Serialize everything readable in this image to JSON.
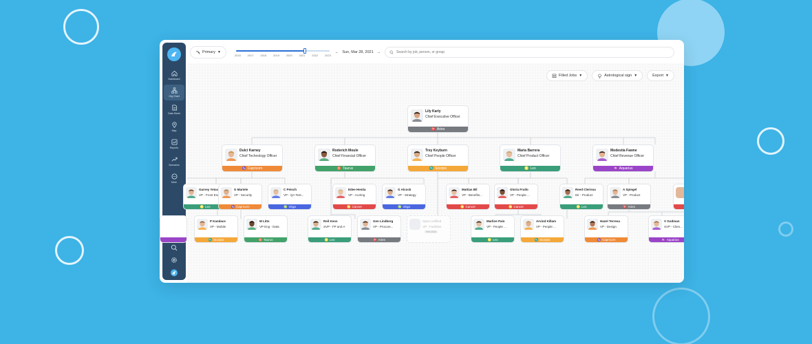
{
  "colors": {
    "background": "#3db3e6",
    "sidebar": "#2c4a68",
    "aries": "#777b80",
    "capricorn": "#ef8a38",
    "taurus": "#43a26a",
    "scorpio": "#f4a83a",
    "leo": "#3a9e7a",
    "aquarius": "#9a45c8",
    "virgo": "#4a67e0",
    "cancer": "#e24a4a"
  },
  "sidebar": {
    "items": [
      {
        "label": "Dashboard",
        "icon": "home-icon"
      },
      {
        "label": "Org Chart",
        "icon": "org-chart-icon",
        "active": true
      },
      {
        "label": "Data Sheet",
        "icon": "sheet-icon"
      },
      {
        "label": "Map",
        "icon": "map-pin-icon"
      },
      {
        "label": "Reports",
        "icon": "report-icon"
      },
      {
        "label": "Scenarios",
        "icon": "scenario-icon"
      },
      {
        "label": "More",
        "icon": "more-icon"
      }
    ],
    "bottom_icons": [
      "eye-icon",
      "search-icon",
      "gear-icon",
      "logo-icon"
    ]
  },
  "toolbar": {
    "view_select": "Primary",
    "years": [
      "2016",
      "2017",
      "2018",
      "2019",
      "2020",
      "2021",
      "2022",
      "2023"
    ],
    "date": "Sun, Mar 28, 2021",
    "search_placeholder": "Search by job, person, or group"
  },
  "filters": {
    "jobs": "Filled Jobs",
    "attribute": "Astrological sign",
    "export": "Export"
  },
  "cards": [
    {
      "id": "lily",
      "name": "Lily Karly",
      "title": "Chief Executive Officer",
      "sign": "Aries",
      "color": "aries",
      "skin": "#d9a37f",
      "hair": "#2a1a14"
    },
    {
      "id": "dulci",
      "name": "Dulci Karney",
      "title": "Chief Technology Officer",
      "sign": "Capricorn",
      "color": "capricorn",
      "skin": "#e8b896",
      "hair": "#c99650"
    },
    {
      "id": "roderich",
      "name": "Roderich Moule",
      "title": "Chief Financial Officer",
      "sign": "Taurus",
      "color": "taurus",
      "skin": "#8a5a3c",
      "hair": "#1f1410"
    },
    {
      "id": "trey",
      "name": "Trey Keyburn",
      "title": "Chief People Officer",
      "sign": "Scorpio",
      "color": "scorpio",
      "skin": "#d8ab86",
      "hair": "#2a2018"
    },
    {
      "id": "maria",
      "name": "Maria Barrera",
      "title": "Chief Product Officer",
      "sign": "Leo",
      "color": "leo",
      "skin": "#e7bfa0",
      "hair": "#c8a878"
    },
    {
      "id": "modestia",
      "name": "Modestia Fawne",
      "title": "Chief Revenue Officer",
      "sign": "Aquarius",
      "color": "aquarius",
      "skin": "#e4b392",
      "hair": "#3b2a20"
    },
    {
      "id": "garvey",
      "name": "Garvey Yetac",
      "title": "VP - Front End",
      "sign": "Leo",
      "color": "leo",
      "skin": "#e3b595",
      "hair": "#6b4a30"
    },
    {
      "id": "gmariele",
      "name": "G Mariele",
      "title": "VP - Security",
      "sign": "Capricorn",
      "color": "capricorn",
      "skin": "#e0b190",
      "hair": "#b08a55"
    },
    {
      "id": "cpeisch",
      "name": "C Peisch",
      "title": "VP - QA Test...",
      "sign": "Virgo",
      "color": "virgo",
      "skin": "#e7c0a2",
      "hair": "#c8b090"
    },
    {
      "id": "edee",
      "name": "Edee Hestia",
      "title": "VP - Accting",
      "sign": "Cancer",
      "color": "cancer",
      "skin": "#ecc3a5",
      "hair": "#d8b888"
    },
    {
      "id": "galcock",
      "name": "G Alcock",
      "title": "VP - Strategy",
      "sign": "Virgo",
      "color": "virgo",
      "skin": "#d9a988",
      "hair": "#2a1e18"
    },
    {
      "id": "mattias",
      "name": "Mattias Bil",
      "title": "VP - Benefits...",
      "sign": "Cancer",
      "color": "cancer",
      "skin": "#e6bd9c",
      "hair": "#1e1a18"
    },
    {
      "id": "gloria",
      "name": "Gloria Fruilo",
      "title": "VP - People ...",
      "sign": "Cancer",
      "color": "cancer",
      "skin": "#7c5038",
      "hair": "#1b120e"
    },
    {
      "id": "reed",
      "name": "Reed Clerissa",
      "title": "Dir - Product",
      "sign": "Leo",
      "color": "leo",
      "skin": "#a56f4e",
      "hair": "#2a1d16"
    },
    {
      "id": "aspiegel",
      "name": "A Spiegel",
      "title": "VP - Product",
      "sign": "Aries",
      "color": "aries",
      "skin": "#e2b596",
      "hair": "#a07a50"
    },
    {
      "id": "pkandace",
      "name": "P Kandace",
      "title": "VP - Mobile",
      "sign": "Scorpio",
      "color": "scorpio",
      "skin": "#e4b899",
      "hair": "#8a6040"
    },
    {
      "id": "mlitts",
      "name": "M Litts",
      "title": "VP Eng - Data",
      "sign": "Taurus",
      "color": "taurus",
      "skin": "#6e4630",
      "hair": "#1a120d"
    },
    {
      "id": "reikeos",
      "name": "Reil Keos",
      "title": "SVP - FP and A",
      "sign": "Leo",
      "color": "leo",
      "skin": "#dcae8c",
      "hair": "#1f1612"
    },
    {
      "id": "gen",
      "name": "Gen Lindberg",
      "title": "VP - Procure...",
      "sign": "Aries",
      "color": "aries",
      "skin": "#e1b493",
      "hair": "#33261c"
    },
    {
      "id": "marline",
      "name": "Marline Pain",
      "title": "VP - People ...",
      "sign": "Leo",
      "color": "leo",
      "skin": "#e8bf9f",
      "hair": "#2c2018"
    },
    {
      "id": "arvind",
      "name": "Arvind Killam",
      "title": "VP - People ...",
      "sign": "Scorpio",
      "color": "scorpio",
      "skin": "#e0b090",
      "hair": "#c49a58"
    },
    {
      "id": "hazel",
      "name": "Hazel Terresa",
      "title": "VP - Design",
      "sign": "Capricorn",
      "color": "capricorn",
      "skin": "#b37652",
      "hair": "#241811"
    },
    {
      "id": "vgodman",
      "name": "V Godman",
      "title": "SVP - Clien...",
      "sign": "Aquarius",
      "color": "aquarius",
      "skin": "#e6ba98",
      "hair": "#9c6e45"
    }
  ],
  "open_job": {
    "name": "Open Unfilled",
    "title": "VP - Facilities",
    "tag": "Feb 2020"
  }
}
